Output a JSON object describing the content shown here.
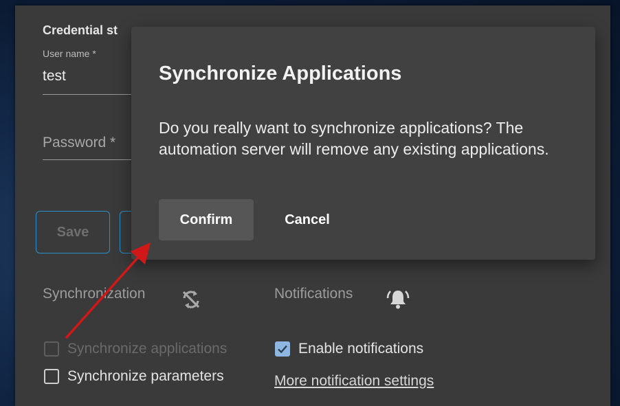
{
  "credentials": {
    "heading": "Credential st",
    "username_label": "User name *",
    "username_value": "test",
    "password_label": "Password *"
  },
  "buttons": {
    "save": "Save"
  },
  "synchronization": {
    "title": "Synchronization",
    "icon": "sync-disabled-icon",
    "sync_applications": "Synchronize applications",
    "sync_parameters": "Synchronize parameters",
    "sync_applications_checked": false,
    "sync_applications_disabled": true,
    "sync_parameters_checked": false
  },
  "notifications": {
    "title": "Notifications",
    "icon": "bell-ringing-icon",
    "enable": "Enable notifications",
    "enable_checked": true,
    "more_settings": "More notification settings"
  },
  "dialog": {
    "title": "Synchronize Applications",
    "message": "Do you really want to synchronize applications? The automation server will remove any existing applications.",
    "confirm": "Confirm",
    "cancel": "Cancel"
  },
  "colors": {
    "accent_outline": "#2e8fc8",
    "annotation_arrow": "#d01818",
    "checkbox_checked": "#8db6e0"
  }
}
